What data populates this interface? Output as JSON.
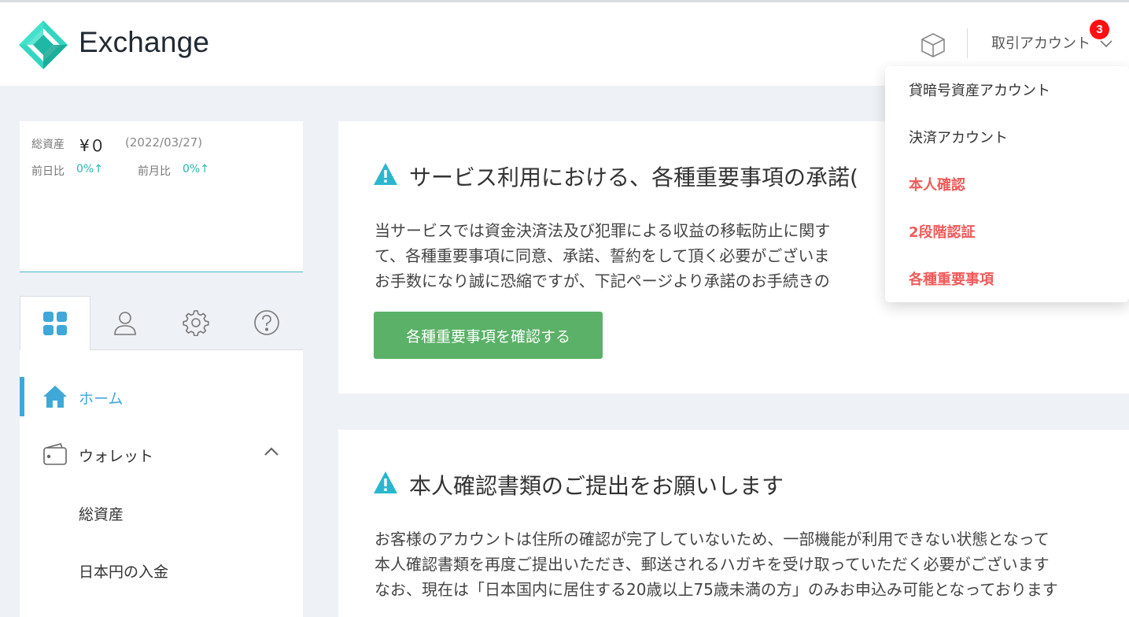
{
  "header": {
    "brand": "Exchange",
    "account_label": "取引アカウント",
    "notification_count": "3"
  },
  "dropdown": {
    "items": [
      {
        "label": "貸暗号資産アカウント",
        "alert": false
      },
      {
        "label": "決済アカウント",
        "alert": false
      },
      {
        "label": "本人確認",
        "alert": true
      },
      {
        "label": "2段階認証",
        "alert": true
      },
      {
        "label": "各種重要事項",
        "alert": true
      }
    ]
  },
  "summary": {
    "total_label": "総資産",
    "total_value": "¥０",
    "date": "(2022/03/27)",
    "prev_day_label": "前日比",
    "prev_day_value": "0%↑",
    "prev_month_label": "前月比",
    "prev_month_value": "0%↑"
  },
  "tabs": [
    {
      "icon": "dashboard-grid-icon"
    },
    {
      "icon": "user-icon"
    },
    {
      "icon": "gear-icon"
    },
    {
      "icon": "help-icon"
    }
  ],
  "nav": {
    "home": "ホーム",
    "wallet": "ウォレット",
    "total_assets": "総資産",
    "jpy_deposit": "日本円の入金"
  },
  "card1": {
    "title": "サービス利用における、各種重要事項の承諾(",
    "lines": [
      "当サービスでは資金決済法及び犯罪による収益の移転防止に関す",
      "て、各種重要事項に同意、承諾、誓約をして頂く必要がございま",
      "お手数になり誠に恐縮ですが、下記ページより承諾のお手続きの"
    ],
    "button": "各種重要事項を確認する"
  },
  "card2": {
    "title": "本人確認書類のご提出をお願いします",
    "lines": [
      "お客様のアカウントは住所の確認が完了していないため、一部機能が利用できない状態となって",
      "本人確認書類を再度ご提出いただき、郵送されるハガキを受け取っていただく必要がございます",
      "なお、現在は「日本国内に居住する20歳以上75歳未満の方」のみお申込み可能となっております"
    ]
  },
  "colors": {
    "accent": "#3fa8d8",
    "teal": "#25b8b0",
    "alert": "#f05a5a",
    "button": "#5ab167",
    "badge": "#ff1010"
  }
}
